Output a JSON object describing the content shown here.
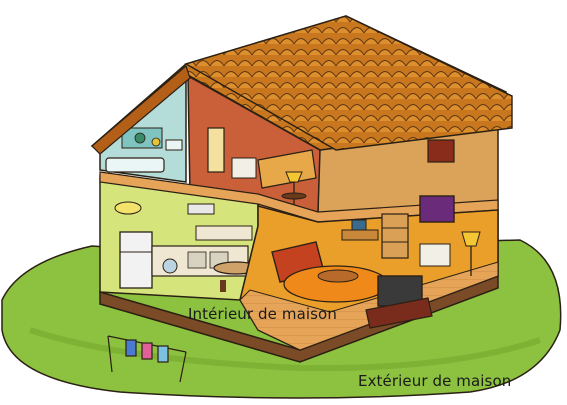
{
  "captions": {
    "interior": "Intérieur de maison",
    "exterior": "Extérieur de maison"
  },
  "colors": {
    "lawn": "#8cc23f",
    "lawn_dark": "#6da22c",
    "roof": "#c9771f",
    "roof_tile": "#d98d2a",
    "exterior_wall": "#dba35a",
    "bathroom_wall": "#b4dcd8",
    "attic_wall": "#c9603a",
    "kitchen_wall": "#d6e47c",
    "living_wall": "#ea9f2b",
    "floor": "#e8a55a",
    "sofa": "#c4421f",
    "rug": "#ef8a1a",
    "outline": "#2b2014"
  }
}
